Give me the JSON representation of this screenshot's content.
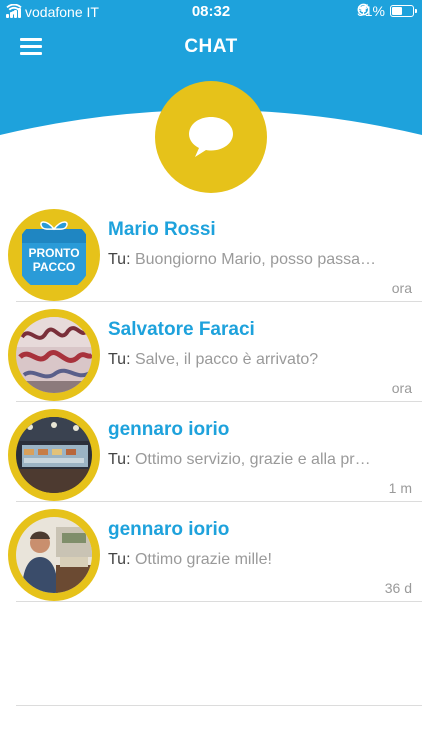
{
  "status": {
    "carrier": "vodafone IT",
    "time": "08:32",
    "battery": "51%",
    "battery_level": 0.51
  },
  "header": {
    "title": "CHAT",
    "menu_icon": "hamburger-menu-icon",
    "badge_icon": "chat-bubble-icon",
    "color": "#1ea2dc",
    "accent": "#e6c21a"
  },
  "chats": [
    {
      "name": "Mario Rossi",
      "you": "Tu:",
      "message": "Buongiorno Mario, posso passa…",
      "time": "ora",
      "avatar": "pronto-pacco-logo",
      "logo_line1": "PRONTO",
      "logo_line2": "PACCO"
    },
    {
      "name": "Salvatore Faraci",
      "you": "Tu:",
      "message": "Salve, il pacco è arrivato?",
      "time": "ora",
      "avatar": "graffiti-photo"
    },
    {
      "name": "gennaro iorio",
      "you": "Tu:",
      "message": "Ottimo servizio, grazie e alla pr…",
      "time": "1 m",
      "avatar": "shop-counter-photo"
    },
    {
      "name": "gennaro iorio",
      "you": "Tu:",
      "message": "Ottimo grazie mille!",
      "time": "36 d",
      "avatar": "person-photo"
    }
  ]
}
